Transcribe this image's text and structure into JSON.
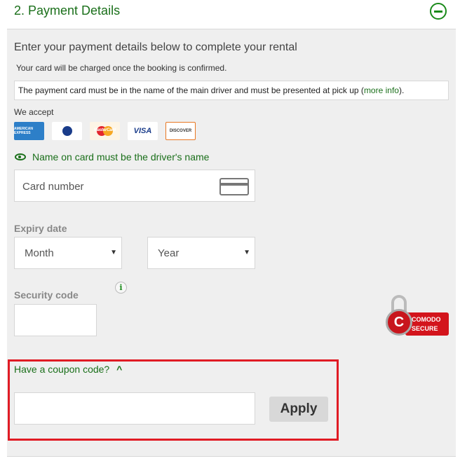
{
  "section": {
    "title": "2. Payment Details"
  },
  "intro": "Enter your payment details below to complete your rental",
  "charge_note": "Your card will be charged once the booking is confirmed.",
  "notice": {
    "text": "The payment card must be in the name of the main driver and must be presented at pick up (",
    "link": "more info",
    "suffix": ")."
  },
  "we_accept": "We accept",
  "cards": [
    "AMERICAN EXPRESS",
    "DINERS",
    "MasterCard",
    "VISA",
    "DISCOVER"
  ],
  "name_msg": "Name on card must be the driver's name",
  "card_number": {
    "placeholder": "Card number",
    "value": ""
  },
  "expiry": {
    "label": "Expiry date",
    "month": "Month",
    "year": "Year"
  },
  "security": {
    "label": "Security code",
    "value": "",
    "info": "i"
  },
  "badge": {
    "line1": "COMODO",
    "line2": "SECURE"
  },
  "coupon": {
    "label": "Have a coupon code?",
    "value": "",
    "apply": "Apply"
  },
  "colors": {
    "accent": "#1a6f1a",
    "highlight": "#e01b24"
  }
}
